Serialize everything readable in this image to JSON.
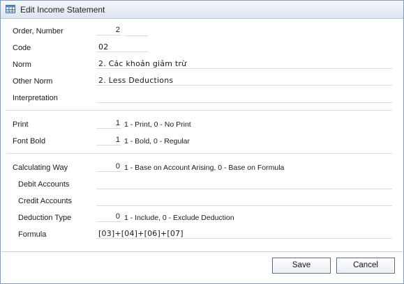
{
  "window": {
    "title": "Edit Income Statement",
    "icon": "table-icon"
  },
  "form": {
    "order_number": {
      "label": "Order, Number",
      "value": "2",
      "value2": ""
    },
    "code": {
      "label": "Code",
      "value": "02"
    },
    "norm": {
      "label": "Norm",
      "value": "2. Các khoản giảm trừ"
    },
    "other_norm": {
      "label": "Other Norm",
      "value": "2. Less Deductions"
    },
    "interpretation": {
      "label": "Interpretation",
      "value": ""
    },
    "print": {
      "label": "Print",
      "value": "1",
      "hint": "1 - Print, 0 - No Print"
    },
    "font_bold": {
      "label": "Font Bold",
      "value": "1",
      "hint": "1 - Bold, 0 - Regular"
    },
    "calculating_way": {
      "label": "Calculating Way",
      "value": "0",
      "hint": "1 - Base on Account Arising, 0 - Base on Formula"
    },
    "debit_accounts": {
      "label": "Debit Accounts",
      "value": ""
    },
    "credit_accounts": {
      "label": "Credit Accounts",
      "value": ""
    },
    "deduction_type": {
      "label": "Deduction Type",
      "value": "0",
      "hint": "1 - Include, 0 - Exclude Deduction"
    },
    "formula": {
      "label": "Formula",
      "value": "[03]+[04]+[06]+[07]"
    }
  },
  "buttons": {
    "save": "Save",
    "cancel": "Cancel"
  }
}
